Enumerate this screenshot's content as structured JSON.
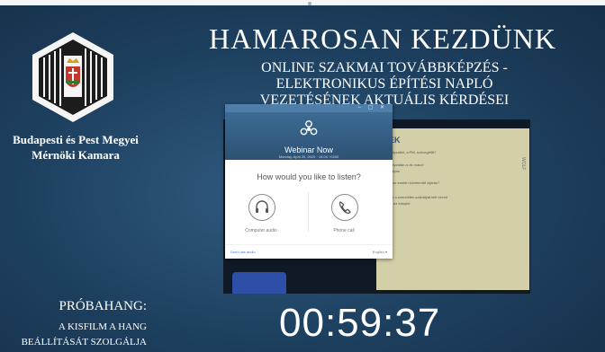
{
  "organization": {
    "name_line1": "Budapesti és Pest Megyei",
    "name_line2": "Mérnöki Kamara"
  },
  "title": "HAMAROSAN KEZDÜNK",
  "subtitle_lines": [
    "ONLINE SZAKMAI TOVÁBBKÉPZÉS -",
    "ELEKTRONIKUS ÉPÍTÉSI NAPLÓ",
    "VEZETÉSÉNEK AKTUÁLIS KÉRDÉSEI"
  ],
  "video": {
    "slide_heading": "SEK",
    "slide_lines": [
      "szabályzattól, a PM, szövegétől?",
      "ani",
      "szabályzatán a vis maior!",
      "szabályos",
      "a maker esetén követendő eljárás?",
      "állozin a szerződés szabályát kell néznil",
      "Ánnyi az iránytól"
    ],
    "slide_brand": "WOLF"
  },
  "dialog": {
    "window_controls": "– ▢ ✕",
    "app_name": "Webinar Now",
    "date": "Monday, April 20, 2020 · 16:04 +0200",
    "question": "How would you like to listen?",
    "options": [
      {
        "label": "Computer audio",
        "icon": "headset-icon"
      },
      {
        "label": "Phone call",
        "icon": "phone-icon"
      }
    ],
    "footer_left": "Don't use audio",
    "footer_right": "English ▾"
  },
  "test_notice": {
    "title": "PRÓBAHANG:",
    "line1": "A KISFILM A HANG",
    "line2": "BEÁLLÍTÁSÁT SZOLGÁLJA"
  },
  "countdown": "00:59:37",
  "colors": {
    "background": "#1d3f5e",
    "dialog_header": "#2d5273",
    "slide_bg": "#d3cfa8"
  }
}
